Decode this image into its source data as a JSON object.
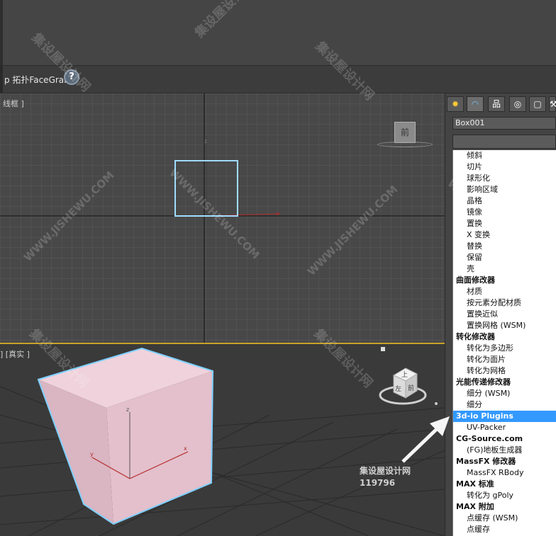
{
  "toolbar": {
    "label": "p  拓扑FaceGrab",
    "help_icon": "?"
  },
  "viewport_top": {
    "label": "线框 ]",
    "viewcube_label": "前"
  },
  "viewport_persp": {
    "label": "] [真实 ]",
    "viewcube_top": "上",
    "viewcube_front": "前",
    "viewcube_left": "左"
  },
  "command_panel": {
    "tabs": [
      "✹",
      "◠",
      "品",
      "◎",
      "▢",
      "⚒"
    ],
    "object_name": "Box001",
    "modifier_list": [
      {
        "label": "倾斜",
        "type": "item"
      },
      {
        "label": "切片",
        "type": "item"
      },
      {
        "label": "球形化",
        "type": "item"
      },
      {
        "label": "影响区域",
        "type": "item"
      },
      {
        "label": "晶格",
        "type": "item"
      },
      {
        "label": "镜像",
        "type": "item"
      },
      {
        "label": "置换",
        "type": "item"
      },
      {
        "label": "X 变换",
        "type": "item"
      },
      {
        "label": "替换",
        "type": "item"
      },
      {
        "label": "保留",
        "type": "item"
      },
      {
        "label": "壳",
        "type": "item"
      },
      {
        "label": "曲面修改器",
        "type": "cat"
      },
      {
        "label": "材质",
        "type": "item"
      },
      {
        "label": "按元素分配材质",
        "type": "item"
      },
      {
        "label": "置换近似",
        "type": "item"
      },
      {
        "label": "置换网格 (WSM)",
        "type": "item"
      },
      {
        "label": "转化修改器",
        "type": "cat"
      },
      {
        "label": "转化为多边形",
        "type": "item"
      },
      {
        "label": "转化为面片",
        "type": "item"
      },
      {
        "label": "转化为网格",
        "type": "item"
      },
      {
        "label": "光能传递修改器",
        "type": "cat"
      },
      {
        "label": "细分 (WSM)",
        "type": "item"
      },
      {
        "label": "细分",
        "type": "item"
      },
      {
        "label": "3d-io Plugins",
        "type": "cat",
        "selected": true
      },
      {
        "label": "UV-Packer",
        "type": "item"
      },
      {
        "label": "CG-Source.com",
        "type": "cat"
      },
      {
        "label": "(FG)地板生成器",
        "type": "item"
      },
      {
        "label": "MassFX 修改器",
        "type": "cat"
      },
      {
        "label": "MassFX RBody",
        "type": "item"
      },
      {
        "label": "MAX 标准",
        "type": "cat"
      },
      {
        "label": "转化为 gPoly",
        "type": "item"
      },
      {
        "label": "MAX 附加",
        "type": "cat"
      },
      {
        "label": "点缓存 (WSM)",
        "type": "item"
      },
      {
        "label": "点缓存",
        "type": "item"
      }
    ]
  },
  "overlay": {
    "site_name": "集设屋设计网",
    "code": "119796"
  },
  "watermark": {
    "cn": "集设屋设计网",
    "en": "WWW.JISHEWU.COM"
  },
  "colors": {
    "selection": "#3399ff",
    "box_face": "#e7c6d1",
    "box_outline": "#7fd0ff",
    "active_border": "#c9a227"
  }
}
